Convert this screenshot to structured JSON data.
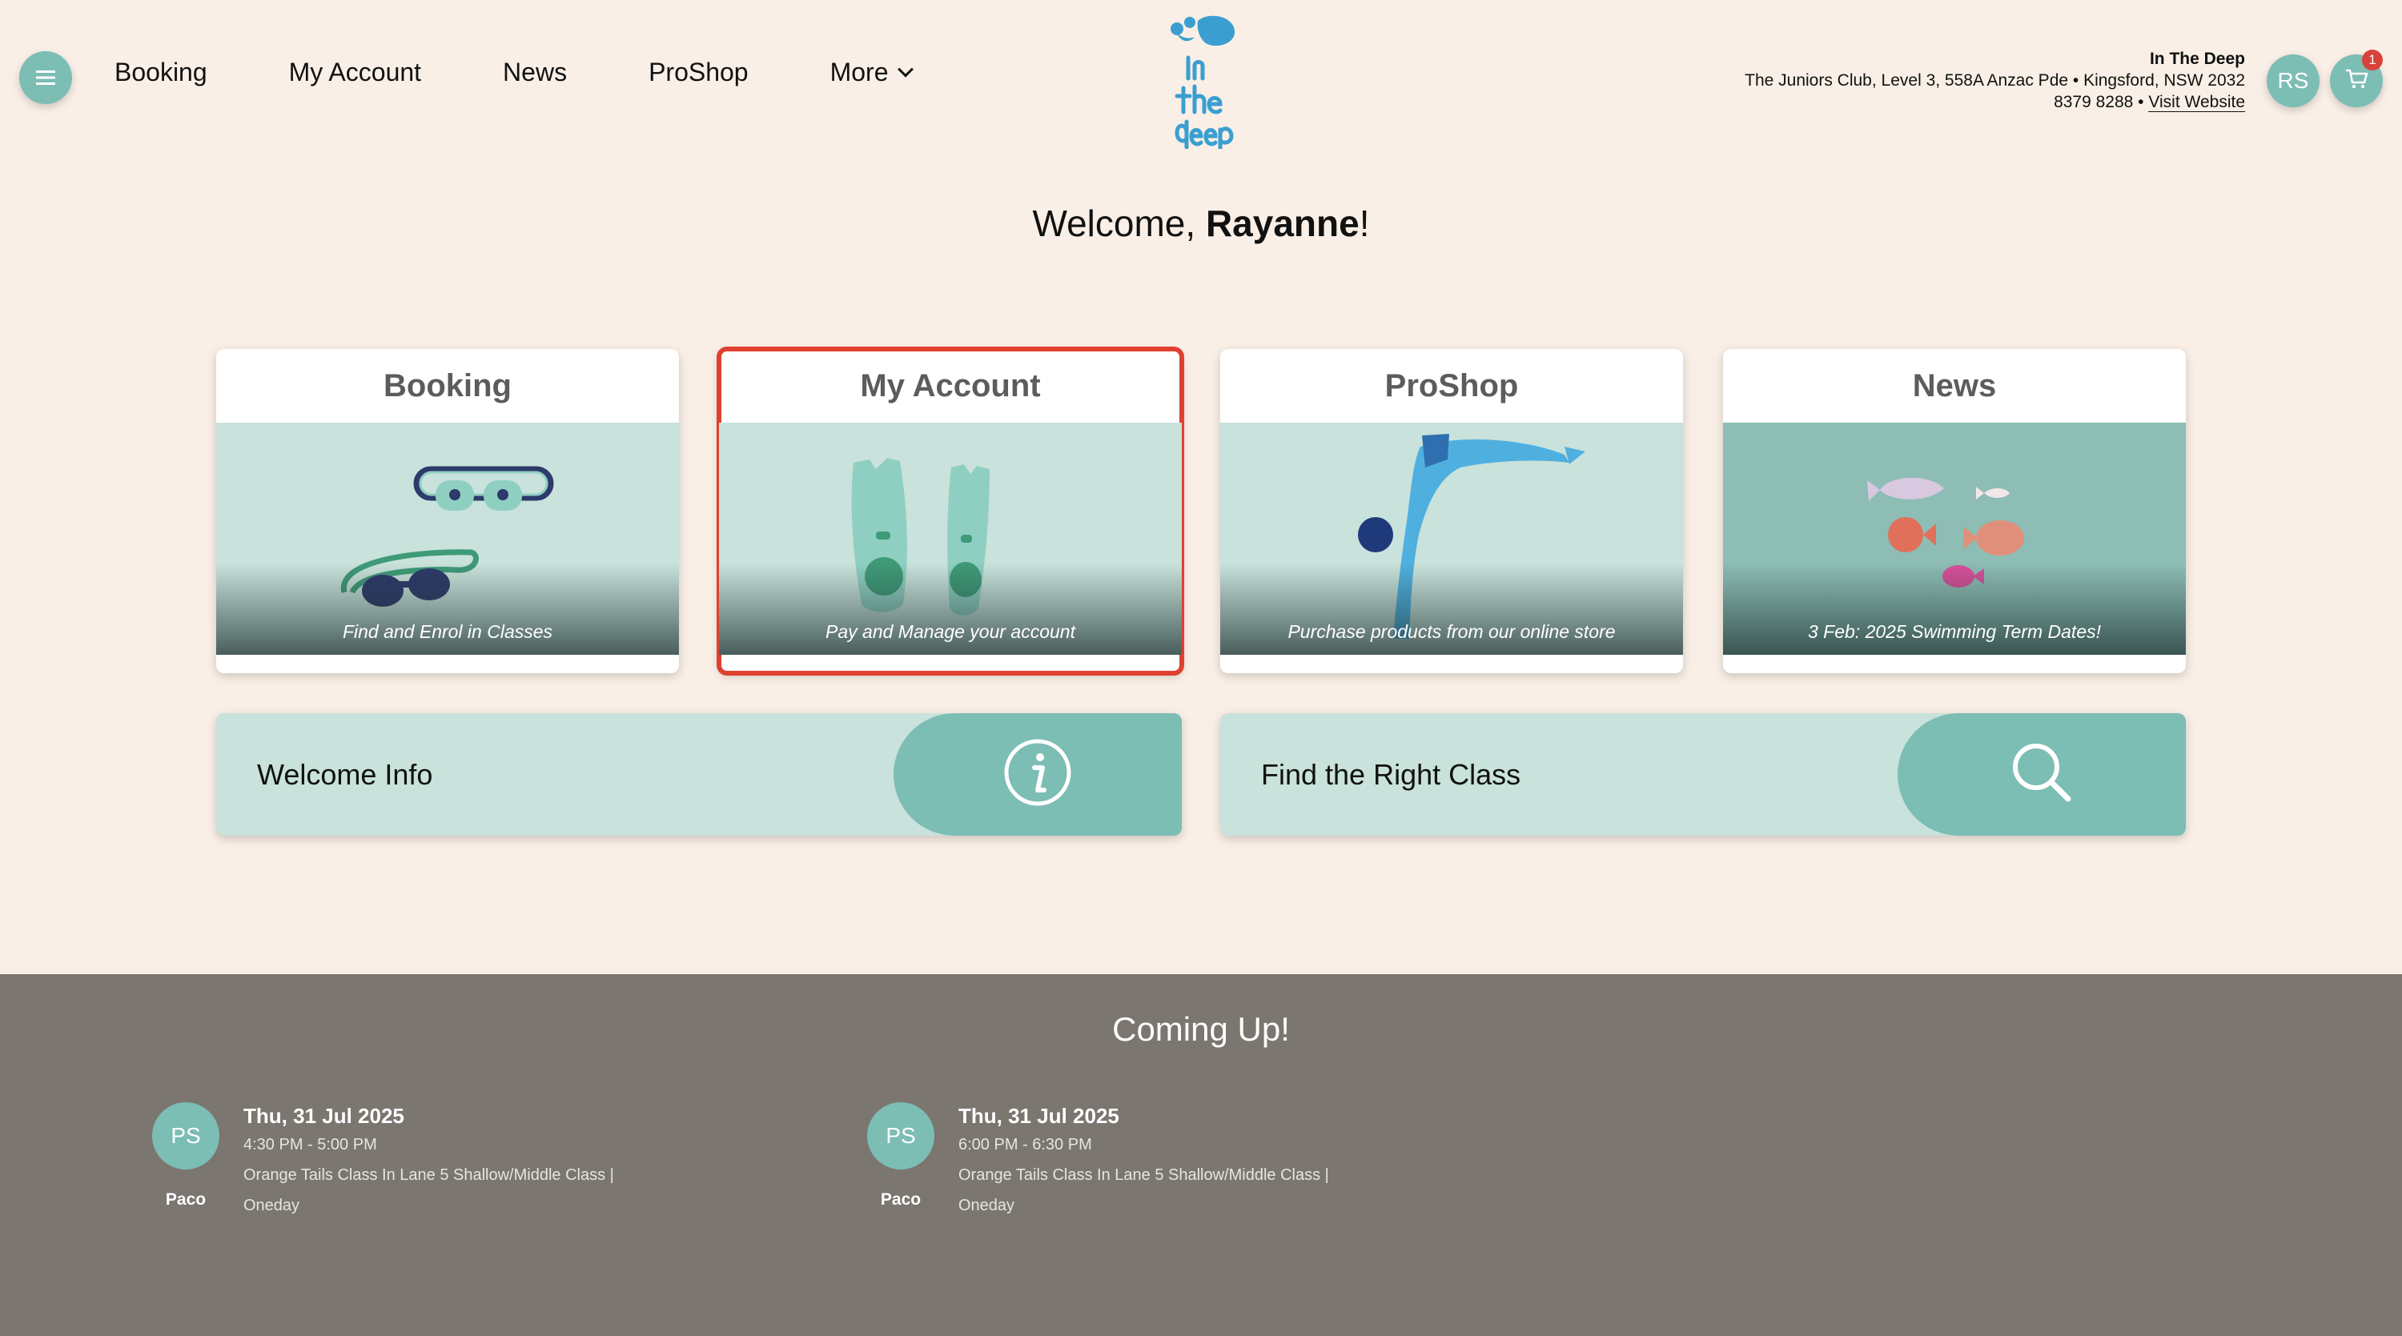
{
  "header": {
    "nav": [
      {
        "label": "Booking"
      },
      {
        "label": "My Account"
      },
      {
        "label": "News"
      },
      {
        "label": "ProShop"
      },
      {
        "label": "More"
      }
    ],
    "logo_text": {
      "line1": "in",
      "line2": "the",
      "line3": "deep"
    },
    "business": {
      "name": "In The Deep",
      "address": "The Juniors Club, Level 3, 558A Anzac Pde • Kingsford, NSW 2032",
      "phone": "8379 8288 •",
      "website_link": "Visit Website"
    },
    "user_initials": "RS",
    "cart_count": "1"
  },
  "welcome": {
    "prefix": "Welcome, ",
    "name": "Rayanne",
    "suffix": "!"
  },
  "cards": [
    {
      "title": "Booking",
      "caption": "Find and Enrol in Classes"
    },
    {
      "title": "My Account",
      "caption": "Pay and Manage your account"
    },
    {
      "title": "ProShop",
      "caption": "Purchase products from our online store"
    },
    {
      "title": "News",
      "caption": "3 Feb:  2025 Swimming Term Dates!"
    }
  ],
  "wide_buttons": [
    {
      "label": "Welcome Info",
      "icon": "info-icon"
    },
    {
      "label": "Find the Right Class",
      "icon": "search-icon"
    }
  ],
  "coming_up": {
    "title": "Coming Up!",
    "events": [
      {
        "initials": "PS",
        "name": "Paco",
        "date": "Thu, 31 Jul 2025",
        "time": "4:30 PM - 5:00 PM",
        "desc": "Orange Tails Class In Lane 5 Shallow/Middle Class | Oneday"
      },
      {
        "initials": "PS",
        "name": "Paco",
        "date": "Thu, 31 Jul 2025",
        "time": "6:00 PM - 6:30 PM",
        "desc": "Orange Tails Class In Lane 5 Shallow/Middle Class | Oneday"
      }
    ]
  },
  "colors": {
    "accent": "#7cbdb4",
    "background": "#f9efe6",
    "footer": "#7b7670",
    "selected_outline": "#e04030",
    "badge": "#d8423a"
  }
}
